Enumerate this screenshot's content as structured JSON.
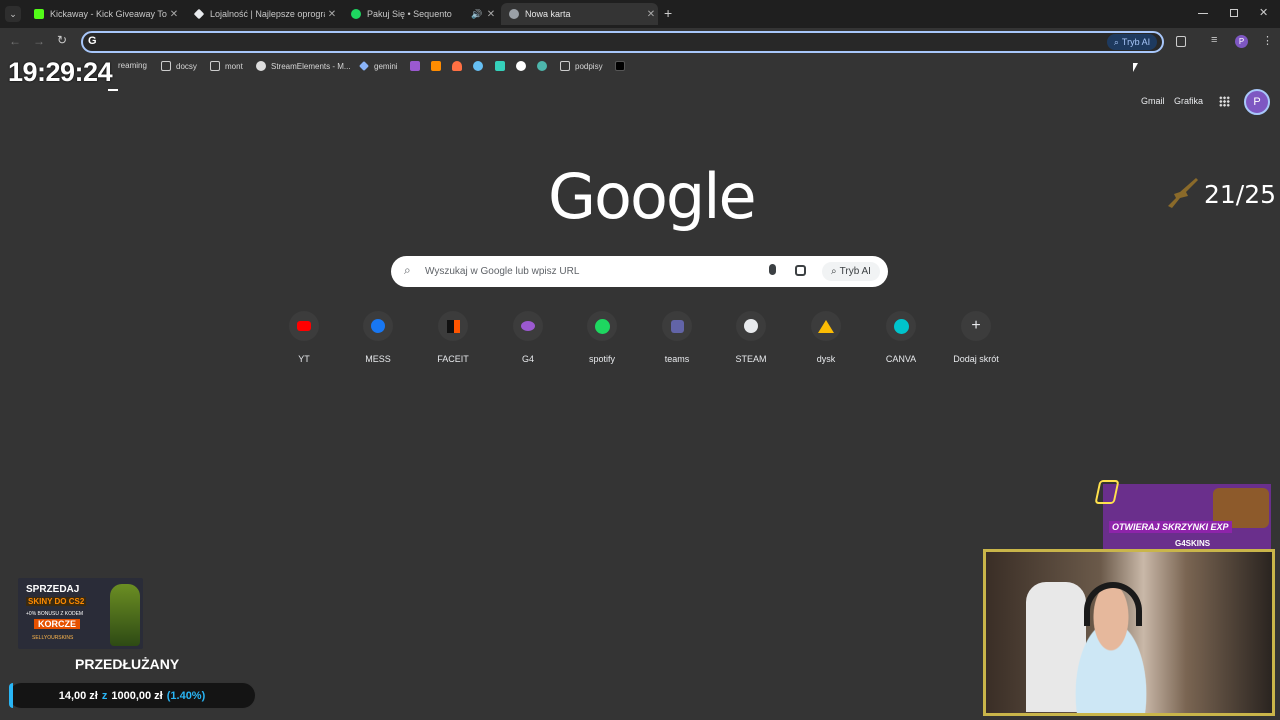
{
  "tabs": [
    {
      "title": "Kickaway - Kick Giveaway Tool",
      "favicon_color": "#53fc18",
      "active": false
    },
    {
      "title": "Lojalność | Najlepsze oprogram",
      "favicon_color": "#e8eaed",
      "active": false
    },
    {
      "title": "Pakuj Się • Sequento",
      "favicon_color": "#1ed760",
      "active": false,
      "audio": true
    },
    {
      "title": "Nowa karta",
      "favicon_color": "#9aa0a6",
      "active": true
    }
  ],
  "toolbar": {
    "omnibox_value": "",
    "tryb_ai_label": "Tryb AI"
  },
  "bookmarks": [
    {
      "label": "reaming",
      "icon": "folder-icon"
    },
    {
      "label": "docsy",
      "icon": "folder-icon"
    },
    {
      "label": "mont",
      "icon": "folder-icon"
    },
    {
      "label": "StreamElements - M...",
      "icon": "streamelements-icon"
    },
    {
      "label": "gemini",
      "icon": "gemini-icon"
    },
    {
      "label": "podpisy",
      "icon": "folder-icon"
    }
  ],
  "overlay": {
    "clock": "19:29:24",
    "counter": "21/25",
    "przedluzany": "PRZEDŁUŻANY",
    "bar_current": "14,00 zł",
    "bar_separator": "z",
    "bar_goal": "1000,00 zł",
    "bar_percent": "(1.40%)",
    "bar_progress": 0.014,
    "promo_left_line1": "SPRZEDAJ",
    "promo_left_line2": "SKINY DO CS2",
    "promo_left_line3": "+0% BONUSU Z KODEM",
    "promo_left_code": "KORCZE",
    "promo_left_brand": "SELLYOURSKINS",
    "promo_right_text": "OTWIERAJ SKRZYNKI EXP",
    "promo_right_brand": "G4SKINS"
  },
  "ntp": {
    "gmail": "Gmail",
    "grafika": "Grafika",
    "avatar_letter": "P",
    "logo": "Google",
    "search_placeholder": "Wyszukaj w Google lub wpisz URL",
    "tryb_ai_label": "Tryb AI",
    "shortcuts": [
      {
        "label": "YT",
        "icon": "youtube-icon",
        "color": "#ff0000"
      },
      {
        "label": "MESS",
        "icon": "messenger-icon",
        "color": "#1877f2"
      },
      {
        "label": "FACEIT",
        "icon": "faceit-icon",
        "color": "#ff5500"
      },
      {
        "label": "G4",
        "icon": "g4-icon",
        "color": "#9b59d0"
      },
      {
        "label": "spotify",
        "icon": "spotify-icon",
        "color": "#1ed760"
      },
      {
        "label": "teams",
        "icon": "teams-icon",
        "color": "#6264a7"
      },
      {
        "label": "STEAM",
        "icon": "steam-icon",
        "color": "#e8eaed"
      },
      {
        "label": "dysk",
        "icon": "drive-icon",
        "color": "#fbbc04"
      },
      {
        "label": "CANVA",
        "icon": "canva-icon",
        "color": "#00c4cc"
      },
      {
        "label": "Dodaj skrót",
        "icon": "plus-icon",
        "color": "#e8eaed"
      }
    ]
  }
}
